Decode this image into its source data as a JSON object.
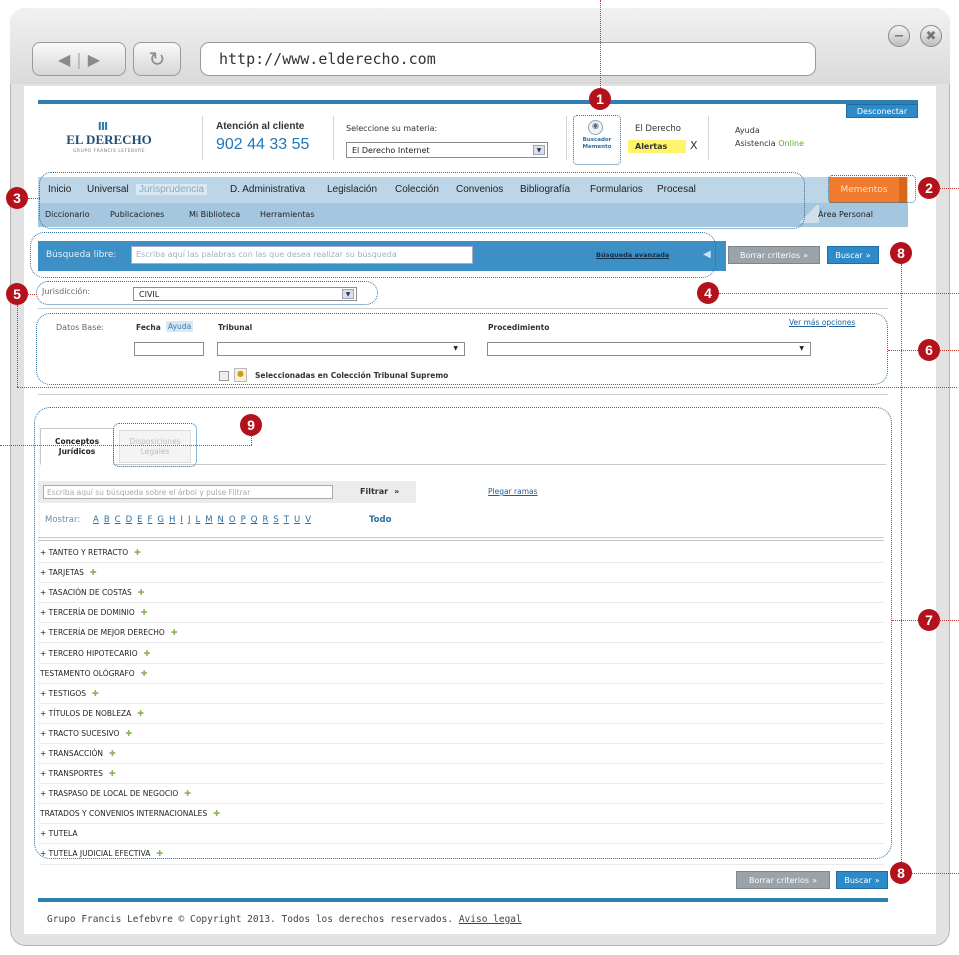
{
  "browser": {
    "url": "http://www.elderecho.com",
    "minimize": "−",
    "close": "✖"
  },
  "header": {
    "logo_main": "EL DERECHO",
    "logo_sub": "GRUPO FRANCIS LEFEBVRE",
    "attention_label": "Atención al cliente",
    "phone": "902 44 33 55",
    "materia_label": "Seleccione su materia:",
    "materia_value": "El Derecho Internet",
    "buscador_label": "Buscador Memento",
    "el_derecho": "El Derecho",
    "alertas": "Alertas",
    "alertas_x": "X",
    "ayuda": "Ayuda",
    "asistencia": "Asistencia",
    "online": "Online",
    "desconectar": "Desconectar"
  },
  "menu": {
    "items": [
      "Inicio",
      "Universal",
      "Jurisprudencia",
      "D. Administrativa",
      "Legislación",
      "Colección",
      "Convenios",
      "Bibliografía",
      "Formularios",
      "Procesal"
    ],
    "mementos": "Mementos",
    "sub_items": [
      "Diccionario",
      "Publicaciones",
      "Mi Biblioteca",
      "Herramientas"
    ],
    "area_personal": "Área Personal"
  },
  "search": {
    "label": "Búsqueda libre:",
    "placeholder": "Escriba aquí las palabras con las que desea realizar su búsqueda",
    "avanzada": "Búsqueda avanzada",
    "borrar": "Borrar criterios",
    "buscar": "Buscar"
  },
  "jurisdiccion": {
    "label": "Jurisdicción:",
    "value": "CIVIL"
  },
  "datos": {
    "label": "Datos Base:",
    "fecha": "Fecha",
    "ayuda": "Ayuda",
    "tribunal": "Tribunal",
    "procedimiento": "Procedimiento",
    "ver_mas": "Ver más opciones",
    "check_label": "Seleccionadas en Colección Tribunal Supremo"
  },
  "tabs": {
    "active": "Conceptos Jurídicos",
    "inactive": "Disposiciones Legales"
  },
  "filter": {
    "placeholder": "Escriba aquí su búsqueda sobre el árbol y pulse Filtrar",
    "button": "Filtrar",
    "plegar": "Plegar ramas"
  },
  "mostrar": {
    "label": "Mostrar:",
    "letters": [
      "A",
      "B",
      "C",
      "D",
      "E",
      "F",
      "G",
      "H",
      "I",
      "J",
      "L",
      "M",
      "N",
      "O",
      "P",
      "Q",
      "R",
      "S",
      "T",
      "U",
      "V"
    ],
    "todo": "Todo"
  },
  "tree": [
    {
      "text": "+ TANTEO Y RETRACTO",
      "add": true
    },
    {
      "text": "+ TARJETAS",
      "add": true
    },
    {
      "text": "+ TASACIÓN DE COSTAS",
      "add": true
    },
    {
      "text": "+ TERCERÍA DE DOMINIO",
      "add": true
    },
    {
      "text": "+ TERCERÍA DE MEJOR DERECHO",
      "add": true
    },
    {
      "text": "+ TERCERO HIPOTECARIO",
      "add": true
    },
    {
      "text": "TESTAMENTO OLÓGRAFO",
      "add": true
    },
    {
      "text": "+ TESTIGOS",
      "add": true
    },
    {
      "text": "+ TÍTULOS DE NOBLEZA",
      "add": true
    },
    {
      "text": "+ TRACTO SUCESIVO",
      "add": true
    },
    {
      "text": "+ TRANSACCIÓN",
      "add": true
    },
    {
      "text": "+ TRANSPORTES",
      "add": true
    },
    {
      "text": "+ TRASPASO DE LOCAL DE NEGOCIO",
      "add": true
    },
    {
      "text": "TRATADOS Y CONVENIOS INTERNACIONALES",
      "add": true
    },
    {
      "text": "+ TUTELA",
      "add": false
    },
    {
      "text": "+ TUTELA JUDICIAL EFECTIVA",
      "add": true
    }
  ],
  "footer": {
    "copyright": "Grupo Francis Lefebvre © Copyright 2013. Todos los derechos reservados.",
    "aviso": "Aviso legal"
  },
  "annotations": [
    "1",
    "2",
    "3",
    "4",
    "5",
    "6",
    "7",
    "8",
    "8",
    "9"
  ],
  "colors": {
    "accent": "#2e8bc9",
    "badge": "#b3111c",
    "mementos": "#f07a2d"
  }
}
